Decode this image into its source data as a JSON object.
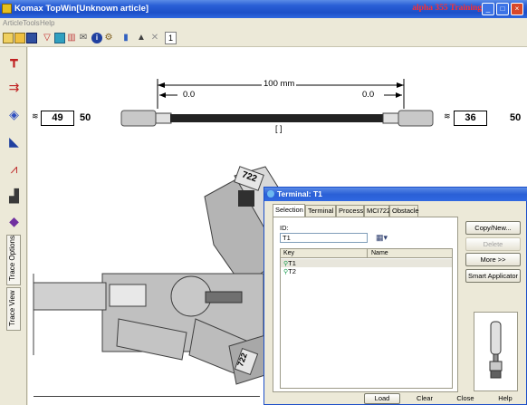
{
  "window": {
    "title": "Komax TopWin[Unknown article]",
    "brand": "alpha 355 Training",
    "controls": [
      "_",
      "□",
      "×"
    ]
  },
  "menu": [
    "Article",
    "Tools",
    "Help"
  ],
  "toolbar": {
    "icons": [
      "new-icon",
      "open-icon",
      "save-icon",
      "filter-icon",
      "display-icon",
      "chart-icon",
      "mail-icon",
      "info-icon",
      "settings-icon",
      "marker-icon",
      "warning-icon",
      "close-icon"
    ],
    "counter": "1"
  },
  "leftbar": {
    "icons": [
      "post-icon",
      "cable-icon",
      "terminal-icon",
      "wire-icon",
      "chart-icon",
      "bars-icon",
      "book-icon"
    ],
    "tabs": [
      "Trace Options",
      "Trace View"
    ]
  },
  "wire": {
    "length_label": "100 mm",
    "left_offset": "0.0",
    "right_offset": "0.0",
    "center_mark": "[ ]",
    "left_box": "49",
    "left_bold": "50",
    "right_box": "36",
    "right_bold": "50"
  },
  "machine": {
    "labels": [
      "722",
      "722"
    ]
  },
  "dialog": {
    "title": "Terminal: T1",
    "tabs": [
      "Selection",
      "Terminal",
      "Process",
      "MCI722",
      "Obstacle"
    ],
    "id_label": "ID:",
    "id_value": "T1",
    "columns": [
      "Key",
      "Name"
    ],
    "rows": [
      {
        "key": "T1"
      },
      {
        "key": "T2"
      }
    ],
    "side_buttons": [
      "Copy/New...",
      "Delete",
      "More >>",
      "Smart Applicator"
    ],
    "bottom_buttons": [
      "Load",
      "Clear",
      "Close",
      "Help"
    ]
  },
  "colors": {
    "titlebar": "#2a5fd6",
    "brand": "#ff3030",
    "machine": "#b0b0b0",
    "wire": "#222222"
  }
}
